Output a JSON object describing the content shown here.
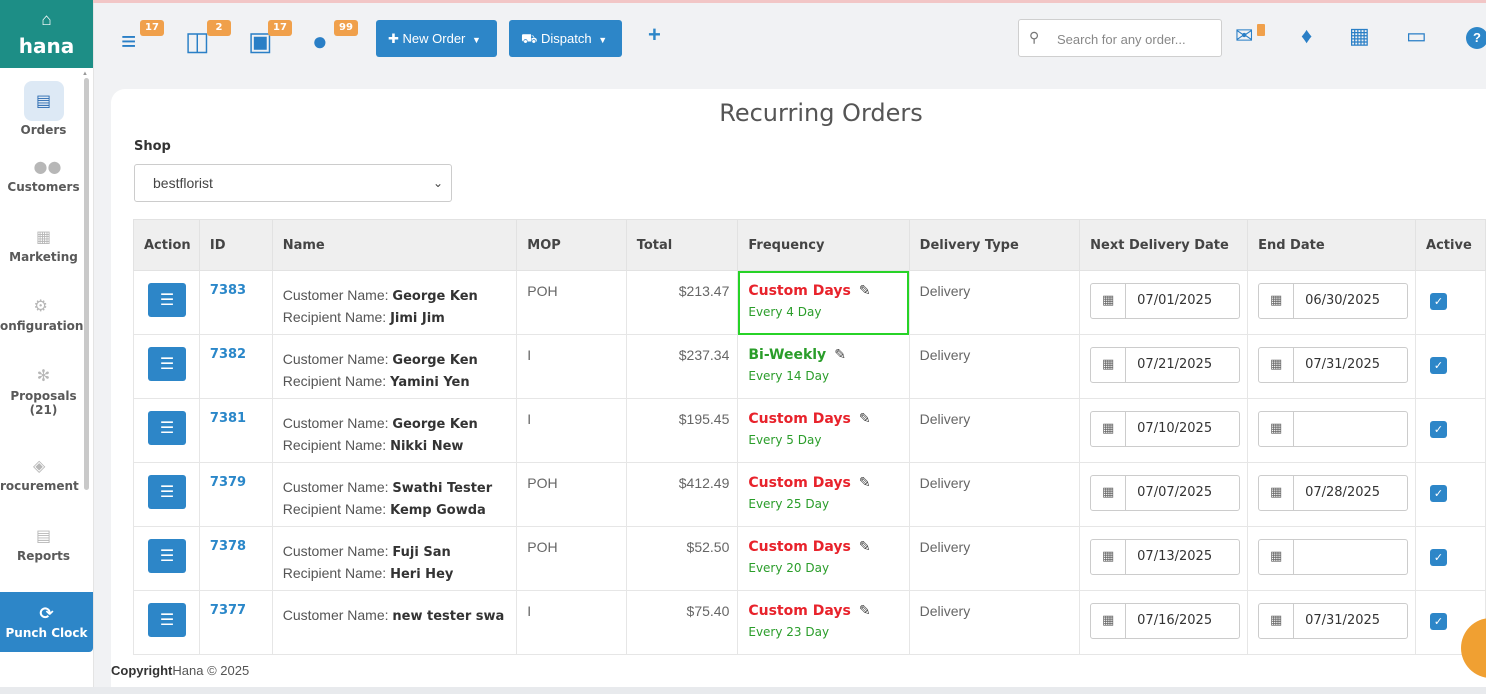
{
  "brand": {
    "name": "hana"
  },
  "sidebar": {
    "items": [
      {
        "label": "Orders",
        "icon": "orders-icon"
      },
      {
        "label": "Customers",
        "icon": "customers-icon"
      },
      {
        "label": "Marketing",
        "icon": "marketing-icon"
      },
      {
        "label": "onfiguration",
        "icon": "configuration-icon"
      },
      {
        "label": "Proposals",
        "sub": "(21)",
        "icon": "proposals-icon"
      },
      {
        "label": "rocurement",
        "icon": "procurement-icon"
      },
      {
        "label": "Reports",
        "icon": "reports-icon"
      }
    ],
    "punch_label": "Punch Clock"
  },
  "topbar": {
    "badges": [
      "17",
      "2",
      "17",
      "99"
    ],
    "new_order_label": "New Order",
    "dispatch_label": "Dispatch",
    "plus_label": "+",
    "search_placeholder": "Search for any order...",
    "help_label": "?"
  },
  "page": {
    "title": "Recurring Orders",
    "shop_label": "Shop",
    "shop_value": "bestflorist"
  },
  "table": {
    "headers": [
      "Action",
      "ID",
      "Name",
      "MOP",
      "Total",
      "Frequency",
      "Delivery Type",
      "Next Delivery Date",
      "End Date",
      "Active"
    ],
    "customer_prefix": "Customer Name: ",
    "recipient_prefix": "Recipient Name: ",
    "rows": [
      {
        "id": "7383",
        "customer": "George Ken",
        "recipient": "Jimi Jim",
        "mop": "POH",
        "total": "$213.47",
        "freq": "Custom Days",
        "freq_sub": "Every 4 Day",
        "freq_color": "red",
        "delivery": "Delivery",
        "next": "07/01/2025",
        "end": "06/30/2025"
      },
      {
        "id": "7382",
        "customer": "George Ken",
        "recipient": "Yamini Yen",
        "mop": "I",
        "total": "$237.34",
        "freq": "Bi-Weekly",
        "freq_sub": "Every 14 Day",
        "freq_color": "green",
        "delivery": "Delivery",
        "next": "07/21/2025",
        "end": "07/31/2025"
      },
      {
        "id": "7381",
        "customer": "George Ken",
        "recipient": "Nikki New",
        "mop": "I",
        "total": "$195.45",
        "freq": "Custom Days",
        "freq_sub": "Every 5 Day",
        "freq_color": "red",
        "delivery": "Delivery",
        "next": "07/10/2025",
        "end": ""
      },
      {
        "id": "7379",
        "customer": "Swathi Tester",
        "recipient": "Kemp Gowda",
        "mop": "POH",
        "total": "$412.49",
        "freq": "Custom Days",
        "freq_sub": "Every 25 Day",
        "freq_color": "red",
        "delivery": "Delivery",
        "next": "07/07/2025",
        "end": "07/28/2025"
      },
      {
        "id": "7378",
        "customer": "Fuji San",
        "recipient": "Heri Hey",
        "mop": "POH",
        "total": "$52.50",
        "freq": "Custom Days",
        "freq_sub": "Every 20 Day",
        "freq_color": "red",
        "delivery": "Delivery",
        "next": "07/13/2025",
        "end": ""
      },
      {
        "id": "7377",
        "customer": "new tester swa",
        "recipient": "",
        "mop": "I",
        "total": "$75.40",
        "freq": "Custom Days",
        "freq_sub": "Every 23 Day",
        "freq_color": "red",
        "delivery": "Delivery",
        "next": "07/16/2025",
        "end": "07/31/2025"
      }
    ]
  },
  "footer": {
    "bold": "Copyright",
    "text": "Hana © 2025"
  },
  "colors": {
    "brand": "#1d8e86",
    "primary": "#2d86c8",
    "badge": "#f0a04b",
    "freq_red": "#e8222b",
    "freq_green": "#2a9d2a",
    "highlight": "#27d327"
  }
}
